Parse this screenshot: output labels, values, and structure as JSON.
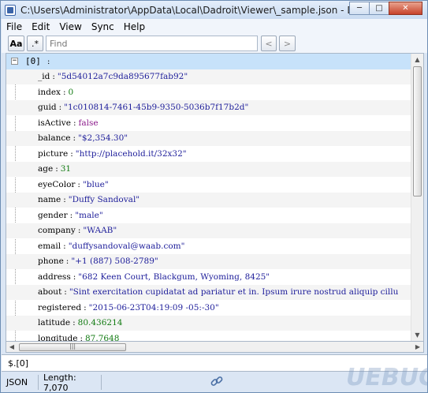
{
  "window": {
    "title": "C:\\Users\\Administrator\\AppData\\Local\\Dadroit\\Viewer\\_sample.json - Dadroit V...",
    "min_icon": "minimize-icon",
    "max_icon": "maximize-icon",
    "close_icon": "close-icon"
  },
  "menu": [
    "File",
    "Edit",
    "View",
    "Sync",
    "Help"
  ],
  "toolbar": {
    "match_case_label": "Aa",
    "regex_label": ".*",
    "find_placeholder": "Find",
    "prev_label": "<",
    "next_label": ">"
  },
  "tree": {
    "root_key": "[0]",
    "root_sep": ":",
    "rows": [
      {
        "key": "_id",
        "value": "\"5d54012a7c9da895677fab92\"",
        "type": "string"
      },
      {
        "key": "index",
        "value": "0",
        "type": "number"
      },
      {
        "key": "guid",
        "value": "\"1c010814-7461-45b9-9350-5036b7f17b2d\"",
        "type": "string"
      },
      {
        "key": "isActive",
        "value": "false",
        "type": "bool"
      },
      {
        "key": "balance",
        "value": "\"$2,354.30\"",
        "type": "string"
      },
      {
        "key": "picture",
        "value": "\"http://placehold.it/32x32\"",
        "type": "string"
      },
      {
        "key": "age",
        "value": "31",
        "type": "number"
      },
      {
        "key": "eyeColor",
        "value": "\"blue\"",
        "type": "string"
      },
      {
        "key": "name",
        "value": "\"Duffy Sandoval\"",
        "type": "string"
      },
      {
        "key": "gender",
        "value": "\"male\"",
        "type": "string"
      },
      {
        "key": "company",
        "value": "\"WAAB\"",
        "type": "string"
      },
      {
        "key": "email",
        "value": "\"duffysandoval@waab.com\"",
        "type": "string"
      },
      {
        "key": "phone",
        "value": "\"+1 (887) 508-2789\"",
        "type": "string"
      },
      {
        "key": "address",
        "value": "\"682 Keen Court, Blackgum, Wyoming, 8425\"",
        "type": "string"
      },
      {
        "key": "about",
        "value": "\"Sint exercitation cupidatat ad pariatur et in. Ipsum irure nostrud aliquip cillu",
        "type": "string"
      },
      {
        "key": "registered",
        "value": "\"2015-06-23T04:19:09 -05:-30\"",
        "type": "string"
      },
      {
        "key": "latitude",
        "value": "80.436214",
        "type": "number"
      },
      {
        "key": "longitude",
        "value": "87.7648",
        "type": "number"
      }
    ]
  },
  "path_bar": "$.[0]",
  "status": {
    "format": "JSON",
    "length": "Length: 7,070"
  },
  "watermark": "UEBUG"
}
